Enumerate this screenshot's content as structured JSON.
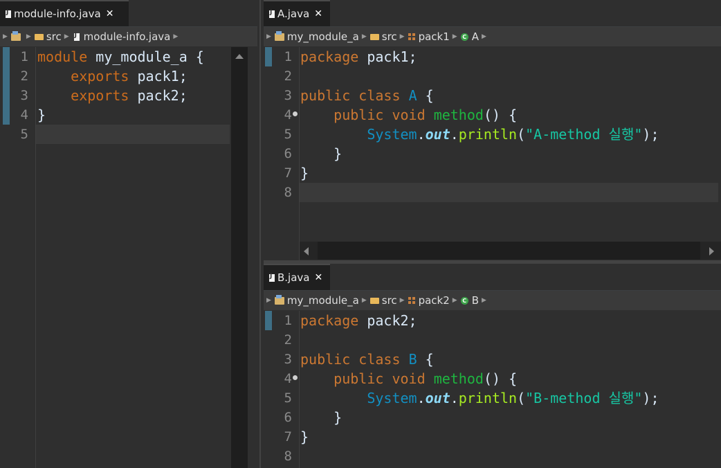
{
  "left": {
    "tab": {
      "title": "module-info.java",
      "close": "✕"
    },
    "crumbs": {
      "src": "src",
      "file": "module-info.java"
    },
    "line_numbers": [
      "1",
      "2",
      "3",
      "4",
      "5"
    ],
    "code": {
      "l1_kw": "module",
      "l1_name": " my_module_a ",
      "l1_brace": "{",
      "l2_kw": "exports",
      "l2_pkg": " pack1;",
      "l3_kw": "exports",
      "l3_pkg": " pack2;",
      "l4": "}"
    }
  },
  "a": {
    "tab": {
      "title": "A.java",
      "close": "✕"
    },
    "crumbs": {
      "project": "my_module_a",
      "src": "src",
      "pkg": "pack1",
      "cls": "A",
      "cls_icon": "C"
    },
    "line_numbers": [
      "1",
      "2",
      "3",
      "4",
      "5",
      "6",
      "7",
      "8"
    ],
    "code": {
      "pkg_kw": "package",
      "pkg_name": " pack1;",
      "pub": "public",
      "class": "class",
      "cls_name": "A",
      "open": "{",
      "m_pub": "public",
      "m_void": "void",
      "m_name": "method",
      "m_paren": "()",
      "m_open": "{",
      "sys": "System",
      "dot1": ".",
      "out": "out",
      "dot2": ".",
      "println": "println",
      "lp": "(",
      "str": "\"A-method 실행\"",
      "rp": ");",
      "close_m": "}",
      "close_c": "}"
    }
  },
  "b": {
    "tab": {
      "title": "B.java",
      "close": "✕"
    },
    "crumbs": {
      "project": "my_module_a",
      "src": "src",
      "pkg": "pack2",
      "cls": "B",
      "cls_icon": "C"
    },
    "line_numbers": [
      "1",
      "2",
      "3",
      "4",
      "5",
      "6",
      "7",
      "8"
    ],
    "code": {
      "pkg_kw": "package",
      "pkg_name": " pack2;",
      "pub": "public",
      "class": "class",
      "cls_name": "B",
      "open": "{",
      "m_pub": "public",
      "m_void": "void",
      "m_name": "method",
      "m_paren": "()",
      "m_open": "{",
      "sys": "System",
      "dot1": ".",
      "out": "out",
      "dot2": ".",
      "println": "println",
      "lp": "(",
      "str": "\"B-method 실행\"",
      "rp": ");",
      "close_m": "}",
      "close_c": "}"
    }
  },
  "colors": {
    "keyword": "#cc7832",
    "class_name": "#1290c3",
    "method_name": "#1eb540",
    "string": "#17c6a3",
    "field": "#8ddaf8",
    "background": "#2f2f2f"
  }
}
